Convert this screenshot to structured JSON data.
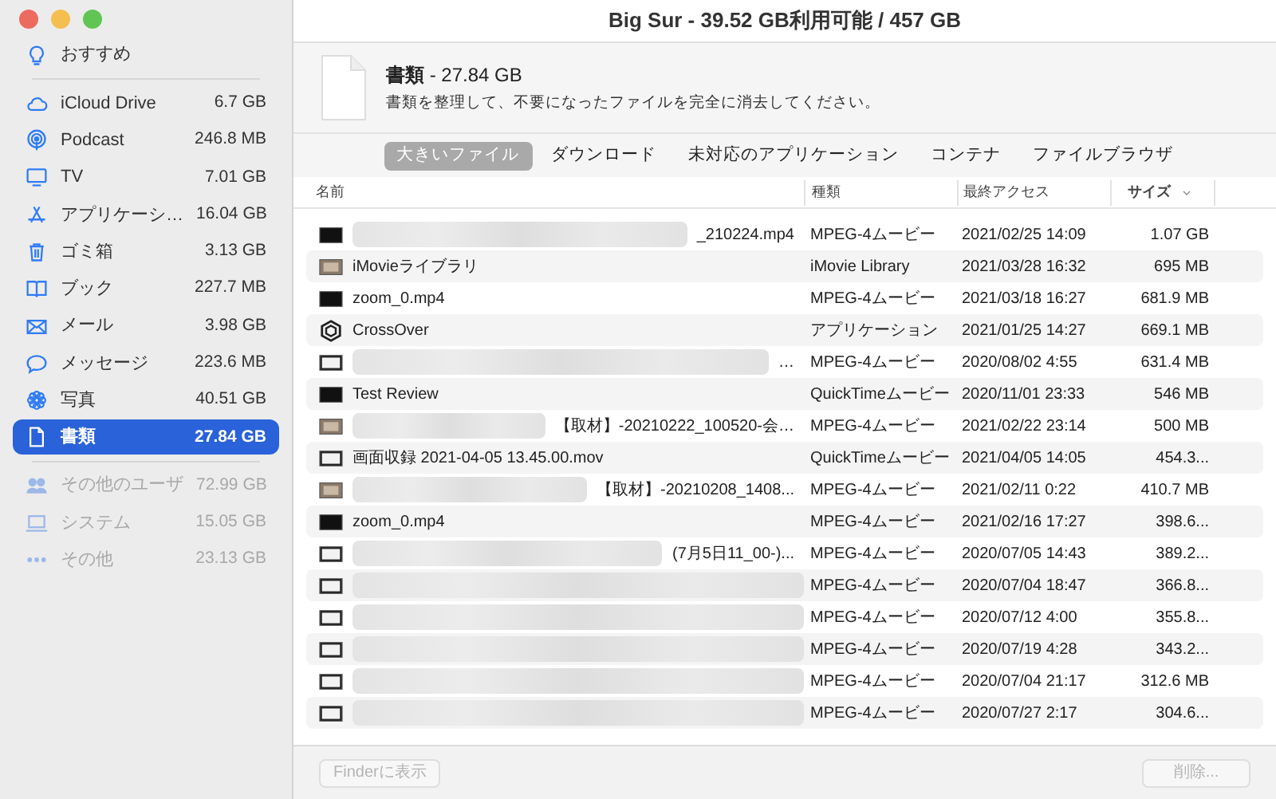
{
  "window": {
    "title": "Big Sur - 39.52 GB利用可能 / 457 GB"
  },
  "sidebar": {
    "items": [
      {
        "kind": "bulb",
        "label": "おすすめ",
        "selected": false,
        "disabled": false
      },
      {
        "kind": "cloud",
        "label": "iCloud Drive",
        "size": "6.7 GB",
        "selected": false,
        "disabled": false
      },
      {
        "kind": "podcast",
        "label": "Podcast",
        "size": "246.8 MB",
        "selected": false,
        "disabled": false
      },
      {
        "kind": "tv",
        "label": "TV",
        "size": "7.01 GB",
        "selected": false,
        "disabled": false
      },
      {
        "kind": "apps",
        "label": "アプリケーシ…",
        "size": "16.04 GB",
        "selected": false,
        "disabled": false
      },
      {
        "kind": "trash",
        "label": "ゴミ箱",
        "size": "3.13 GB",
        "selected": false,
        "disabled": false
      },
      {
        "kind": "book",
        "label": "ブック",
        "size": "227.7 MB",
        "selected": false,
        "disabled": false
      },
      {
        "kind": "mail",
        "label": "メール",
        "size": "3.98 GB",
        "selected": false,
        "disabled": false
      },
      {
        "kind": "message",
        "label": "メッセージ",
        "size": "223.6 MB",
        "selected": false,
        "disabled": false
      },
      {
        "kind": "photos",
        "label": "写真",
        "size": "40.51 GB",
        "selected": false,
        "disabled": false
      },
      {
        "kind": "document",
        "label": "書類",
        "size": "27.84 GB",
        "selected": true,
        "disabled": false
      },
      {
        "kind": "users",
        "label": "その他のユーザ",
        "size": "72.99 GB",
        "selected": false,
        "disabled": true
      },
      {
        "kind": "laptop",
        "label": "システム",
        "size": "15.05 GB",
        "selected": false,
        "disabled": true
      },
      {
        "kind": "more",
        "label": "その他",
        "size": "23.13 GB",
        "selected": false,
        "disabled": true
      }
    ]
  },
  "header": {
    "title_bold": "書類",
    "title_rest": " - 27.84 GB",
    "description": "書類を整理して、不要になったファイルを完全に消去してください。"
  },
  "tabs": [
    {
      "label": "大きいファイル",
      "selected": true
    },
    {
      "label": "ダウンロード",
      "selected": false
    },
    {
      "label": "未対応のアプリケーション",
      "selected": false
    },
    {
      "label": "コンテナ",
      "selected": false
    },
    {
      "label": "ファイルブラウザ",
      "selected": false
    }
  ],
  "table": {
    "columns": [
      {
        "label": "名前",
        "sorted": false
      },
      {
        "label": "種類",
        "sorted": false
      },
      {
        "label": "最終アクセス",
        "sorted": false
      },
      {
        "label": "サイズ",
        "sorted": true
      }
    ],
    "rows": [
      {
        "kind": "movie",
        "redacted": true,
        "name": "_210224.mp4",
        "type": "MPEG-4ムービー",
        "accessed": "2021/02/25 14:09",
        "size": "1.07 GB"
      },
      {
        "kind": "filmstrip",
        "redacted": false,
        "name": "iMovieライブラリ",
        "type": "iMovie Library",
        "accessed": "2021/03/28 16:32",
        "size": "695 MB"
      },
      {
        "kind": "movie",
        "redacted": false,
        "name": "zoom_0.mp4",
        "type": "MPEG-4ムービー",
        "accessed": "2021/03/18 16:27",
        "size": "681.9 MB"
      },
      {
        "kind": "app",
        "redacted": false,
        "name": "CrossOver",
        "type": "アプリケーション",
        "accessed": "2021/01/25 14:27",
        "size": "669.1 MB"
      },
      {
        "kind": "screen",
        "redacted": true,
        "name": "…",
        "type": "MPEG-4ムービー",
        "accessed": "2020/08/02 4:55",
        "size": "631.4 MB"
      },
      {
        "kind": "movie",
        "redacted": false,
        "name": "Test Review",
        "type": "QuickTimeムービー",
        "accessed": "2020/11/01 23:33",
        "size": "546 MB"
      },
      {
        "kind": "filmstrip",
        "redacted": true,
        "name": "【取材】-20210222_100520-会…",
        "type": "MPEG-4ムービー",
        "accessed": "2021/02/22 23:14",
        "size": "500 MB"
      },
      {
        "kind": "screen",
        "redacted": false,
        "name": "画面収録 2021-04-05 13.45.00.mov",
        "type": "QuickTimeムービー",
        "accessed": "2021/04/05 14:05",
        "size": "454.3..."
      },
      {
        "kind": "filmstrip",
        "redacted": true,
        "name": "【取材】-20210208_1408...",
        "type": "MPEG-4ムービー",
        "accessed": "2021/02/11 0:22",
        "size": "410.7 MB"
      },
      {
        "kind": "movie",
        "redacted": false,
        "name": "zoom_0.mp4",
        "type": "MPEG-4ムービー",
        "accessed": "2021/02/16 17:27",
        "size": "398.6..."
      },
      {
        "kind": "screen",
        "redacted": true,
        "name": "(7月5日11_00-)...",
        "type": "MPEG-4ムービー",
        "accessed": "2020/07/05 14:43",
        "size": "389.2..."
      },
      {
        "kind": "screen",
        "redacted": true,
        "type": "MPEG-4ムービー",
        "accessed": "2020/07/04 18:47",
        "size": "366.8..."
      },
      {
        "kind": "screen",
        "redacted": true,
        "type": "MPEG-4ムービー",
        "accessed": "2020/07/12 4:00",
        "size": "355.8..."
      },
      {
        "kind": "screen",
        "redacted": true,
        "type": "MPEG-4ムービー",
        "accessed": "2020/07/19 4:28",
        "size": "343.2..."
      },
      {
        "kind": "screen",
        "redacted": true,
        "type": "MPEG-4ムービー",
        "accessed": "2020/07/04 21:17",
        "size": "312.6 MB"
      },
      {
        "kind": "screen",
        "redacted": true,
        "type": "MPEG-4ムービー",
        "accessed": "2020/07/27 2:17",
        "size": "304.6..."
      }
    ]
  },
  "footer": {
    "buttons": [
      {
        "label": "Finderに表示",
        "disabled": true
      },
      {
        "label": "削除...",
        "disabled": true
      }
    ]
  }
}
